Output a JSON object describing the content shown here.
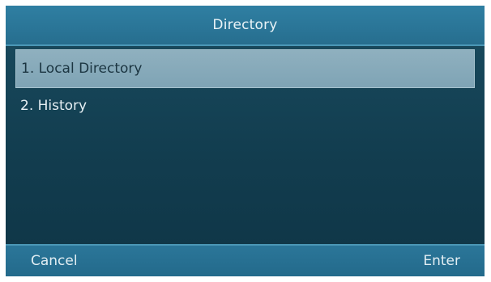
{
  "title": "Directory",
  "menu": {
    "items": [
      {
        "label": "1. Local Directory",
        "selected": true
      },
      {
        "label": "2. History",
        "selected": false
      }
    ]
  },
  "softkeys": {
    "left": "Cancel",
    "right": "Enter"
  },
  "colors": {
    "title_bar": "#2a7597",
    "background": "#123d4f",
    "selection": "#8fb0bf",
    "softkey_bar": "#236a8b"
  }
}
